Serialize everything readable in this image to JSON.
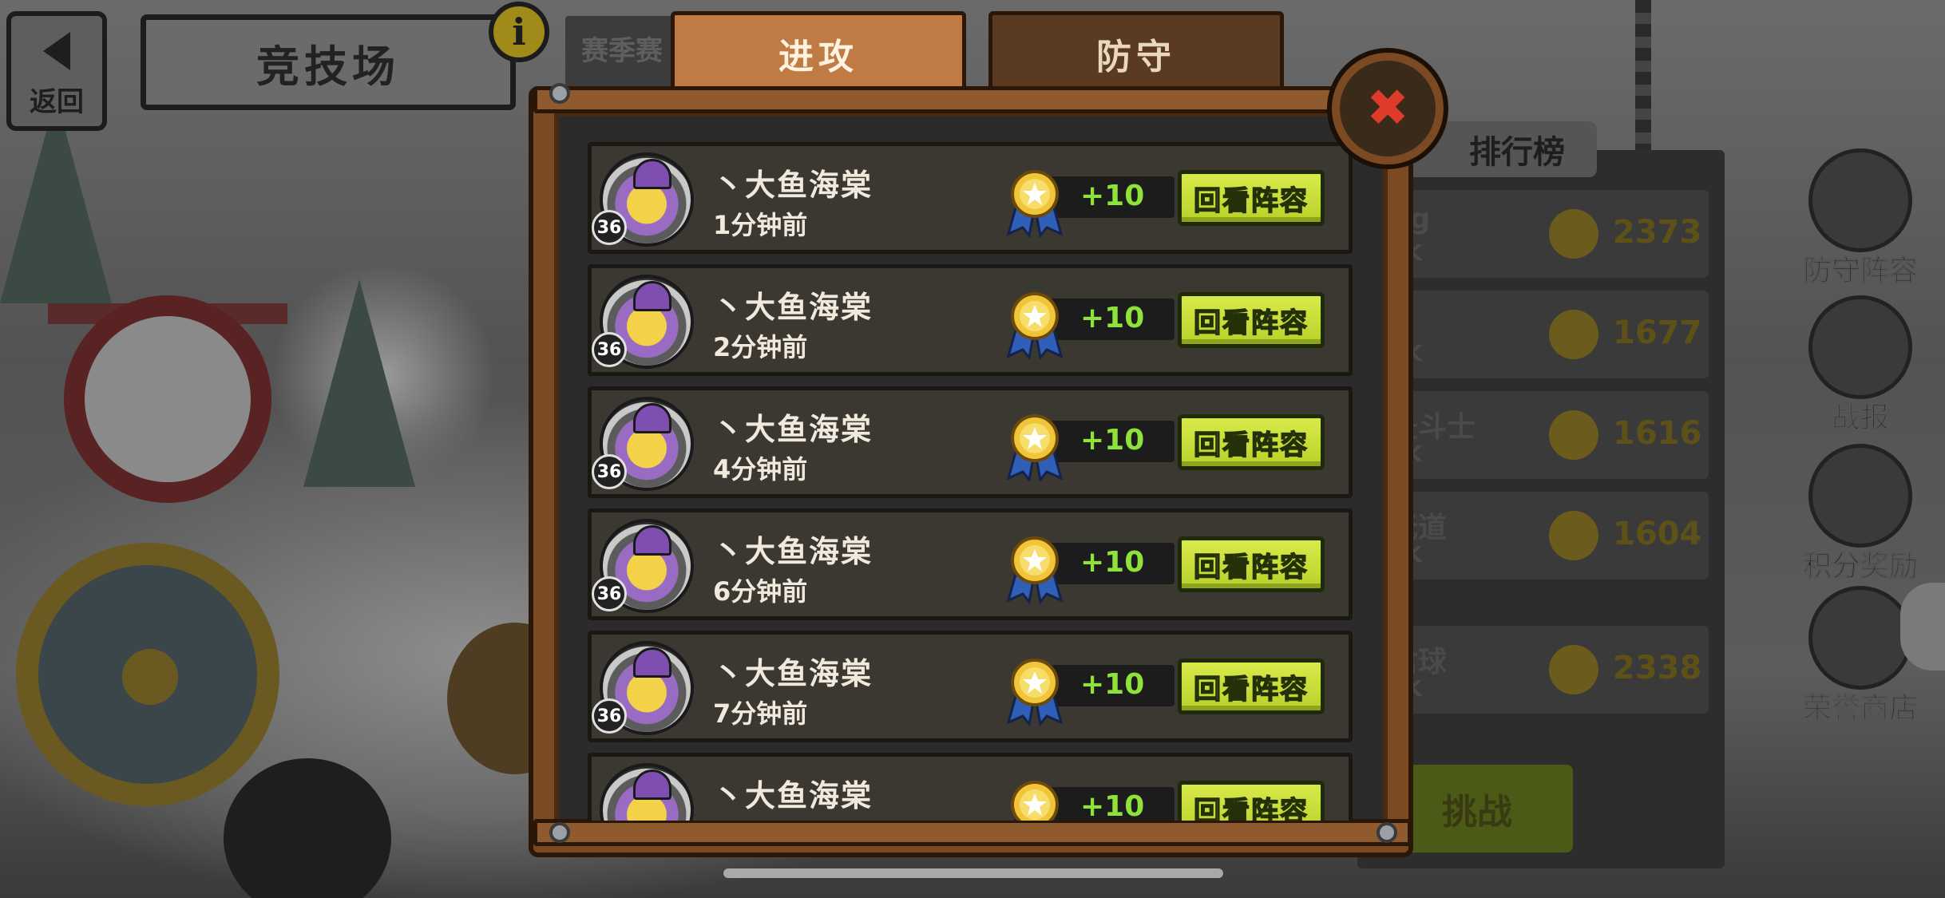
{
  "header": {
    "back_label": "返回",
    "title": "竞技场",
    "info_glyph": "i"
  },
  "tabs": [
    {
      "label": "进攻",
      "active": true
    },
    {
      "label": "防守",
      "active": false
    }
  ],
  "background_panel": {
    "partial_label": "赛季赛",
    "leaderboard_title": "排行榜",
    "rows": [
      {
        "name": "ng",
        "sub": "9K",
        "score": "2373"
      },
      {
        "name": "",
        "sub": "1K",
        "score": "1677"
      },
      {
        "name": "圣斗士",
        "sub": "8K",
        "score": "1616"
      },
      {
        "name": "无道",
        "sub": "0K",
        "score": "1604"
      },
      {
        "name": "君球",
        "sub": "9K",
        "score": "2338"
      }
    ],
    "challenge_label": "挑战"
  },
  "side_menu": [
    {
      "label": "防守阵容",
      "icon": "shield-icon"
    },
    {
      "label": "战报",
      "icon": "scroll-icon"
    },
    {
      "label": "积分奖励",
      "icon": "medal-icon"
    },
    {
      "label": "荣誉商店",
      "icon": "gem-icon"
    }
  ],
  "modal": {
    "close_glyph": "✖",
    "records": [
      {
        "level": "36",
        "name": "丶大鱼海棠",
        "time": "1分钟前",
        "delta": "+10",
        "button": "回看阵容"
      },
      {
        "level": "36",
        "name": "丶大鱼海棠",
        "time": "2分钟前",
        "delta": "+10",
        "button": "回看阵容"
      },
      {
        "level": "36",
        "name": "丶大鱼海棠",
        "time": "4分钟前",
        "delta": "+10",
        "button": "回看阵容"
      },
      {
        "level": "36",
        "name": "丶大鱼海棠",
        "time": "6分钟前",
        "delta": "+10",
        "button": "回看阵容"
      },
      {
        "level": "36",
        "name": "丶大鱼海棠",
        "time": "7分钟前",
        "delta": "+10",
        "button": "回看阵容"
      },
      {
        "level": "36",
        "name": "丶大鱼海棠",
        "time": "",
        "delta": "+10",
        "button": "回看阵容"
      }
    ]
  },
  "colors": {
    "accent_button": "#c7dd36",
    "delta_green": "#8ee23a",
    "frame_wood": "#7b4a23",
    "close_red": "#e03a2a"
  }
}
